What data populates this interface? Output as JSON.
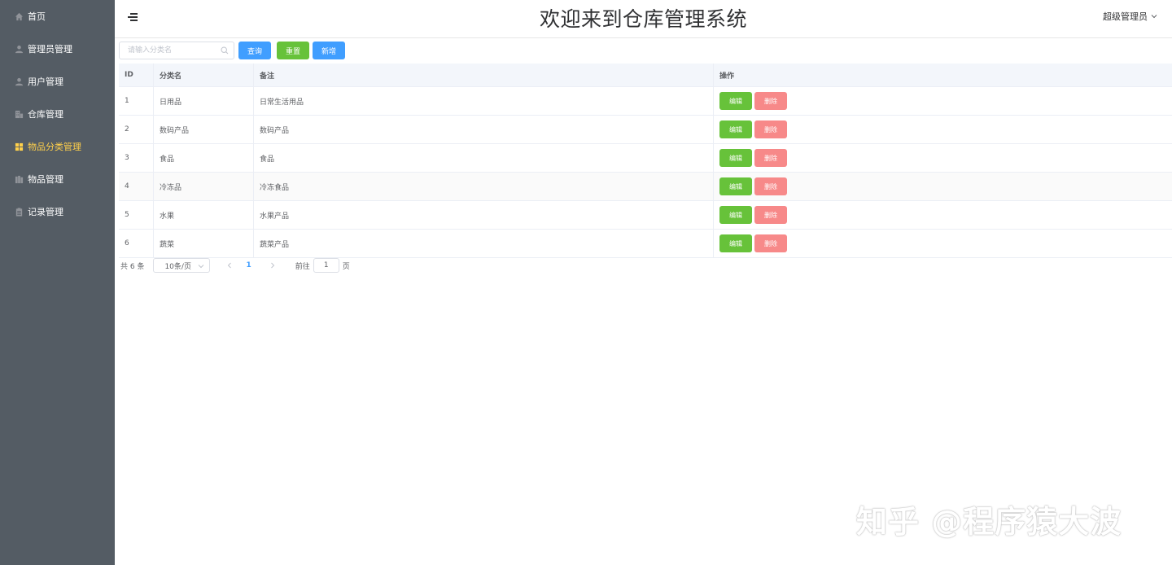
{
  "sidebar": {
    "items": [
      {
        "label": "首页",
        "icon": "home-icon"
      },
      {
        "label": "管理员管理",
        "icon": "user-icon"
      },
      {
        "label": "用户管理",
        "icon": "user-icon"
      },
      {
        "label": "仓库管理",
        "icon": "building-icon"
      },
      {
        "label": "物品分类管理",
        "icon": "grid-icon",
        "active": true
      },
      {
        "label": "物品管理",
        "icon": "goods-icon"
      },
      {
        "label": "记录管理",
        "icon": "clipboard-icon"
      }
    ],
    "active_color": "#ffd04b",
    "bg_color": "#545c64"
  },
  "header": {
    "title": "欢迎来到仓库管理系统",
    "user": "超级管理员"
  },
  "toolbar": {
    "search_placeholder": "请输入分类名",
    "search_value": "",
    "query_label": "查询",
    "reset_label": "重置",
    "add_label": "新增"
  },
  "table": {
    "headers": [
      "ID",
      "分类名",
      "备注",
      "操作"
    ],
    "rows": [
      {
        "id": "1",
        "name": "日用品",
        "remark": "日常生活用品"
      },
      {
        "id": "2",
        "name": "数码产品",
        "remark": "数码产品"
      },
      {
        "id": "3",
        "name": "食品",
        "remark": "食品"
      },
      {
        "id": "4",
        "name": "冷冻品",
        "remark": "冷冻食品"
      },
      {
        "id": "5",
        "name": "水果",
        "remark": "水果产品"
      },
      {
        "id": "6",
        "name": "蔬菜",
        "remark": "蔬菜产品"
      }
    ],
    "edit_label": "编辑",
    "delete_label": "删除"
  },
  "pagination": {
    "total": "共 6 条",
    "page_size": "10条/页",
    "current_page": "1",
    "goto_label": "前往",
    "goto_value": "1",
    "goto_suffix": "页"
  },
  "watermark": "知乎 @程序猿大波"
}
